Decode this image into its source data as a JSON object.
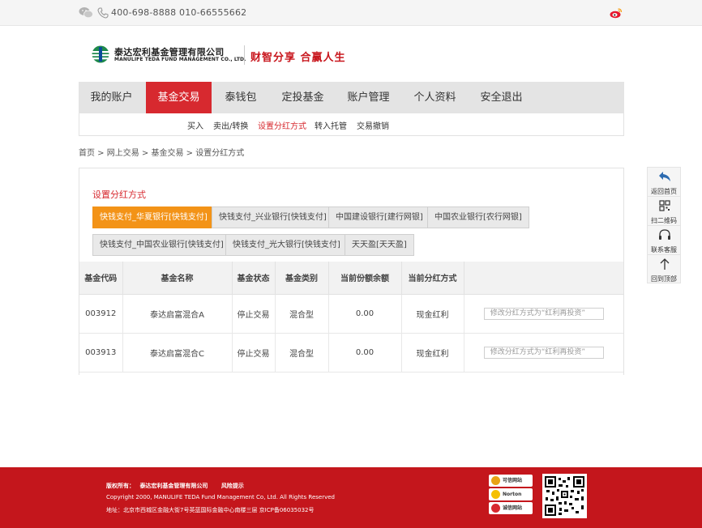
{
  "topbar": {
    "phones": "400-698-8888 010-66555662",
    "icons": [
      "wechat-icon",
      "phone-icon",
      "weibo-icon"
    ]
  },
  "header": {
    "company_cn": "泰达宏利基金管理有限公司",
    "company_en": "MANULIFE TEDA FUND MANAGEMENT CO., LTD.",
    "slogan": "财智分享  合赢人生"
  },
  "nav": {
    "items": [
      {
        "label": "我的账户"
      },
      {
        "label": "基金交易"
      },
      {
        "label": "泰钱包"
      },
      {
        "label": "定投基金"
      },
      {
        "label": "账户管理"
      },
      {
        "label": "个人资料"
      },
      {
        "label": "安全退出"
      }
    ],
    "active": "基金交易"
  },
  "subnav": {
    "items": [
      {
        "label": "买入"
      },
      {
        "label": "卖出/转换"
      },
      {
        "label": "设置分红方式"
      },
      {
        "label": "转入托管"
      },
      {
        "label": "交易撤销"
      }
    ],
    "active": "设置分红方式"
  },
  "breadcrumb": "首页 > 网上交易 > 基金交易 > 设置分红方式",
  "panel": {
    "title": "设置分红方式",
    "banks": [
      {
        "label": "快钱支付_华夏银行[快钱支付]",
        "active": true
      },
      {
        "label": "快钱支付_兴业银行[快钱支付]"
      },
      {
        "label": "中国建设银行[建行网银]"
      },
      {
        "label": "中国农业银行[农行网银]"
      },
      {
        "label": "快钱支付_中国农业银行[快钱支付]"
      },
      {
        "label": "快钱支付_光大银行[快钱支付]"
      },
      {
        "label": "天天盈[天天盈]"
      }
    ],
    "table": {
      "headers": [
        "基金代码",
        "基金名称",
        "基金状态",
        "基金类别",
        "当前份额余额",
        "当前分红方式",
        ""
      ],
      "rows": [
        {
          "code": "003912",
          "name": "泰达启富混合A",
          "status": "停止交易",
          "category": "混合型",
          "balance": "0.00",
          "dividend": "现金红利",
          "action": "修改分红方式为“红利再投资”"
        },
        {
          "code": "003913",
          "name": "泰达启富混合C",
          "status": "停止交易",
          "category": "混合型",
          "balance": "0.00",
          "dividend": "现金红利",
          "action": "修改分红方式为“红利再投资”"
        }
      ]
    }
  },
  "side": {
    "items": [
      {
        "label": "返回首页",
        "icon": "back-arrow-icon"
      },
      {
        "label": "扫二维码",
        "icon": "qrcode-icon"
      },
      {
        "label": "联系客服",
        "icon": "headset-icon"
      },
      {
        "label": "回到顶部",
        "icon": "arrow-up-icon"
      }
    ]
  },
  "footer": {
    "copyright_label": "版权所有：",
    "company": "泰达宏利基金管理有限公司",
    "risk": "风险提示",
    "copyright_en": "Copyright 2000, MANULIFE TEDA Fund Management Co, Ltd. All Rights Reserved",
    "address": "地址：北京市西城区金融大街7号英蓝国际金融中心南楼三层 京ICP备06035032号",
    "badges": [
      {
        "label": "可信网站",
        "color": "#e8a316"
      },
      {
        "label": "Norton",
        "color": "#f5c000"
      },
      {
        "label": "诚信网站",
        "color": "#d7292f"
      }
    ]
  },
  "colors": {
    "brand_red": "#d7292f",
    "accent_orange": "#f39317",
    "footer_red": "#c4161c"
  }
}
